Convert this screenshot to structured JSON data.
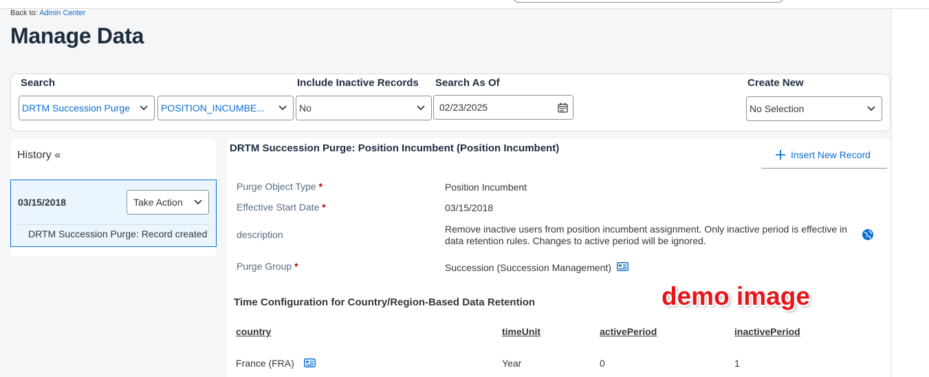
{
  "header": {
    "back_prefix": "Back to:",
    "back_link": "Admin Center",
    "title": "Manage Data"
  },
  "filters": {
    "search_label": "Search",
    "search_type": "DRTM Succession Purge",
    "search_record": "POSITION_INCUMBE...",
    "inactive_label": "Include Inactive Records",
    "inactive_value": "No",
    "as_of_label": "Search As Of",
    "as_of_value": "02/23/2025",
    "create_label": "Create New",
    "create_value": "No Selection"
  },
  "history": {
    "title": "History «",
    "item_date": "03/15/2018",
    "action_label": "Take Action",
    "item_note": "DRTM Succession Purge: Record created"
  },
  "record": {
    "title": "DRTM Succession Purge: Position Incumbent (Position Incumbent)",
    "insert_label": "Insert New Record",
    "required_mark": "*",
    "fields": [
      {
        "label": "Purge Object Type",
        "value": "Position Incumbent"
      },
      {
        "label": "Effective Start Date",
        "value": "03/15/2018"
      },
      {
        "label": "description",
        "value": "Remove inactive users from position incumbent assignment. Only inactive period is effective in data retention rules. Changes to active period will be ignored."
      },
      {
        "label": "Purge Group",
        "value": "Succession (Succession Management)"
      }
    ]
  },
  "time_config": {
    "title": "Time Configuration for Country/Region-Based Data Retention",
    "columns": [
      "country",
      "timeUnit",
      "activePeriod",
      "inactivePeriod"
    ],
    "rows": [
      {
        "country": "France (FRA)",
        "timeUnit": "Year",
        "activePeriod": "0",
        "inactivePeriod": "1"
      }
    ]
  },
  "watermark": "demo image",
  "icons": {
    "dropdown": "chevron-down-icon",
    "calendar": "calendar-icon",
    "plus": "add-icon",
    "globe": "globe-icon",
    "details": "business-card-icon"
  },
  "colors": {
    "accent": "#0a6ed1",
    "required": "#bb0000",
    "title": "#1d2d3e",
    "watermark": "#e8151b"
  }
}
